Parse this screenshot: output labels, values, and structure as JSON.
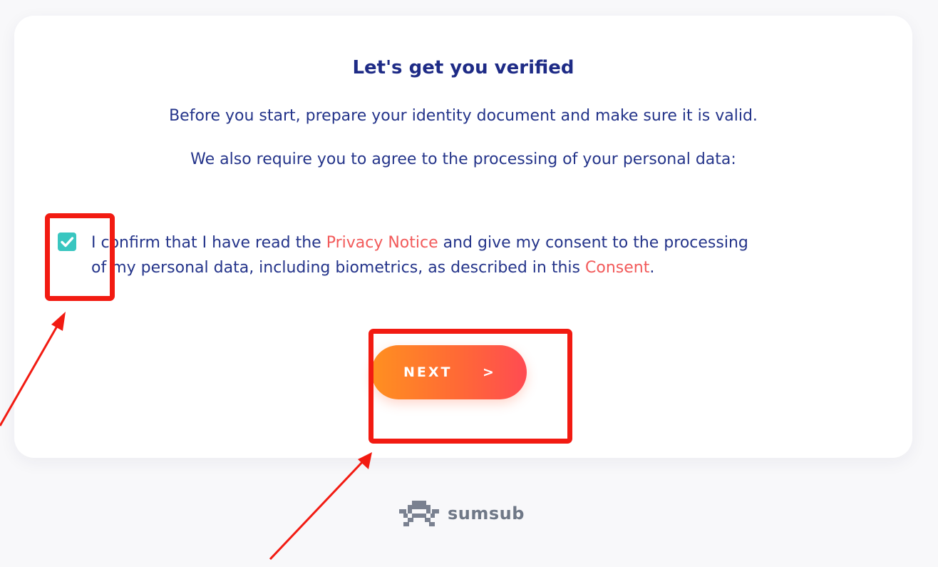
{
  "card": {
    "title": "Let's get you verified",
    "prepare_text": "Before you start, prepare your identity document and make sure it is valid.",
    "agree_text": "We also require you to agree to the processing of your personal data:"
  },
  "consent": {
    "checked": true,
    "text_1": "I confirm that I have read the ",
    "privacy_link": "Privacy Notice",
    "text_2": " and give my consent to the processing of my personal data, including biometrics, as described in this ",
    "consent_link": "Consent",
    "text_3": "."
  },
  "next_button": {
    "label": "NEXT",
    "chevron": ">"
  },
  "footer": {
    "brand_name": "sumsub"
  },
  "icons": {
    "checkbox": "check-icon",
    "logo": "sumsub-logo-icon"
  },
  "colors": {
    "title": "#1e2b86",
    "text": "#24348a",
    "link": "#f25a5a",
    "checkbox": "#39c6c0",
    "button_start": "#ff9020",
    "button_end": "#ff4b52",
    "annotation": "#f21b12"
  }
}
